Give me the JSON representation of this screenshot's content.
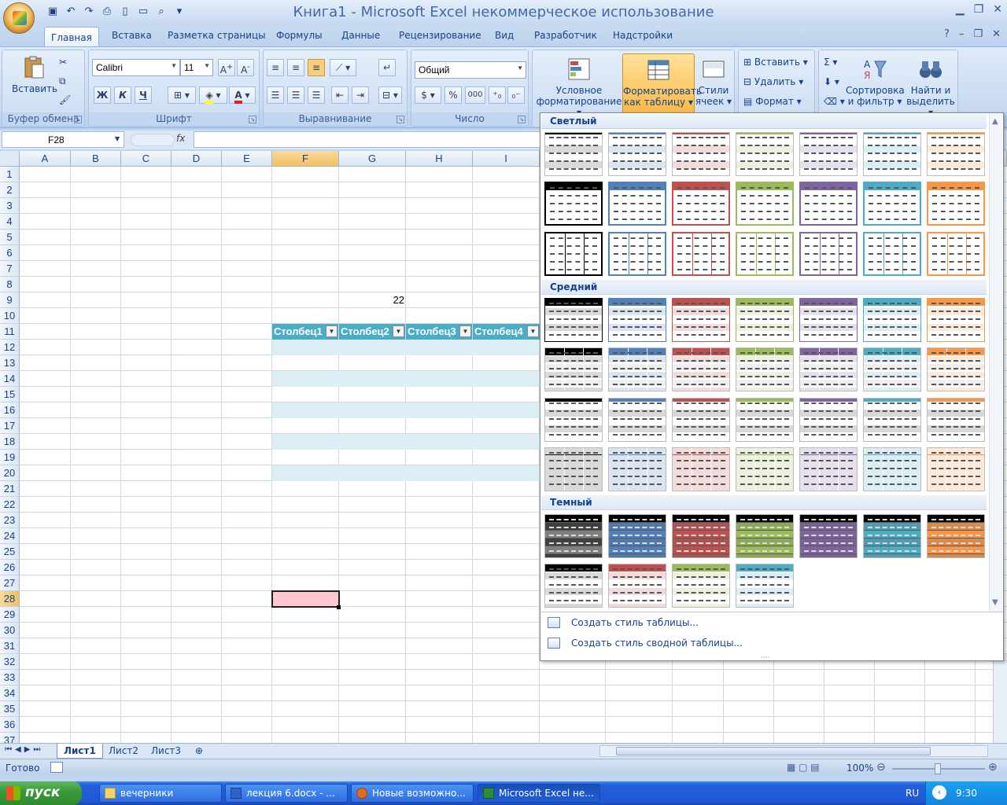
{
  "window": {
    "title": "Книга1 - Microsoft Excel некоммерческое использование"
  },
  "tabs": [
    "Главная",
    "Вставка",
    "Разметка страницы",
    "Формулы",
    "Данные",
    "Рецензирование",
    "Вид",
    "Разработчик",
    "Надстройки"
  ],
  "ribbon": {
    "clipboard": {
      "paste": "Вставить",
      "label": "Буфер обмена"
    },
    "font": {
      "name": "Calibri",
      "size": "11",
      "bold": "Ж",
      "italic": "К",
      "underline": "Ч",
      "label": "Шрифт",
      "font_color": "#e02020",
      "fill_color": "#ffff00"
    },
    "alignment": {
      "label": "Выравнивание"
    },
    "number": {
      "format": "Общий",
      "percent": "%",
      "thousands": "000",
      "label": "Число"
    },
    "styles": {
      "conditional": [
        "Условное",
        "форматирование"
      ],
      "format_table": [
        "Форматировать",
        "как таблицу"
      ],
      "cell_styles": [
        "Стили",
        "ячеек"
      ]
    },
    "cells": {
      "insert": "Вставить",
      "delete": "Удалить",
      "format": "Формат"
    },
    "editing": {
      "sort": [
        "Сортировка",
        "и фильтр"
      ],
      "find": [
        "Найти и",
        "выделить"
      ]
    }
  },
  "formula_bar": {
    "name_box": "F28",
    "fx": "fx",
    "value": ""
  },
  "columns": [
    "A",
    "B",
    "C",
    "D",
    "E",
    "F",
    "G",
    "H",
    "I"
  ],
  "selected_column": "F",
  "selected_row": "28",
  "rows": [
    "1",
    "2",
    "3",
    "4",
    "5",
    "6",
    "7",
    "8",
    "9",
    "10",
    "11",
    "12",
    "13",
    "14",
    "15",
    "16",
    "17",
    "18",
    "19",
    "20",
    "21",
    "22",
    "23",
    "24",
    "25",
    "26",
    "27",
    "28",
    "29",
    "30",
    "31",
    "32",
    "33",
    "34",
    "35",
    "36",
    "37"
  ],
  "cells": {
    "G9": "22"
  },
  "table_headers": [
    "Столбец1",
    "Столбец2",
    "Столбец3",
    "Столбец4"
  ],
  "table_style_colors": {
    "header": "#4bacc6",
    "band": "#daeef3"
  },
  "gallery": {
    "sections": [
      "Светлый",
      "Средний",
      "Темный"
    ],
    "colors": [
      "#000000",
      "#4f81bd",
      "#c0504d",
      "#9bbb59",
      "#8064a2",
      "#4bacc6",
      "#f79646"
    ],
    "light_colors": [
      "#d9d9d9",
      "#dbe5f1",
      "#f2dcdb",
      "#ebf1de",
      "#e5e0ec",
      "#daeef3",
      "#fde9d9"
    ],
    "menu": [
      "Создать стиль таблицы...",
      "Создать стиль сводной таблицы..."
    ]
  },
  "sheet_tabs": [
    "Лист1",
    "Лист2",
    "Лист3"
  ],
  "status": {
    "ready": "Готово",
    "zoom": "100%"
  },
  "taskbar": {
    "start": "пуск",
    "tasks": [
      "вечерники",
      "лекция 6.docx - ...",
      "Новые возможно...",
      "Microsoft Excel не..."
    ],
    "lang": "RU",
    "clock": "9:30"
  }
}
